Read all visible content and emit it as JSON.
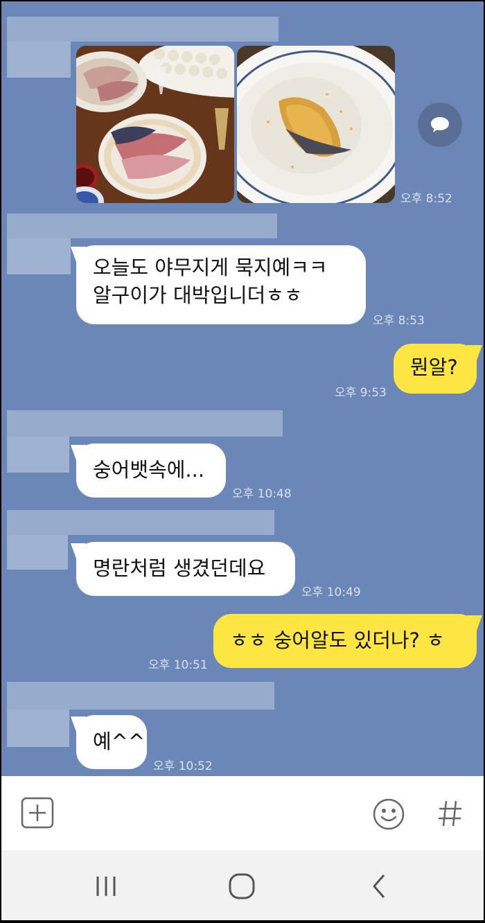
{
  "messages": {
    "m1_time": "오후 8:52",
    "m2_text_line1": "오늘도 야무지게 묵지예ㅋㅋ",
    "m2_text_line2": "알구이가 대박입니더ㅎㅎ",
    "m2_time": "오후 8:53",
    "m3_text": "뭔알?",
    "m3_time": "오후 9:53",
    "m4_text": "숭어뱃속에...",
    "m4_time": "오후 10:48",
    "m5_text": "명란처럼 생겼던데요",
    "m5_time": "오후 10:49",
    "m6_text": "ㅎㅎ 숭어알도 있더나? ㅎ",
    "m6_time": "오후 10:51",
    "m7_text": "예^^",
    "m7_time": "오후 10:52"
  },
  "icons": {
    "share": "share-speech-bubble-icon",
    "attach": "plus-square-icon",
    "emoji": "smiley-icon",
    "hashtag": "hashtag-icon",
    "nav_recent": "recent-apps-icon",
    "nav_home": "home-icon",
    "nav_back": "back-icon"
  },
  "colors": {
    "chat_background": "#6b87b8",
    "incoming_bubble": "#ffffff",
    "outgoing_bubble": "#fde642"
  }
}
